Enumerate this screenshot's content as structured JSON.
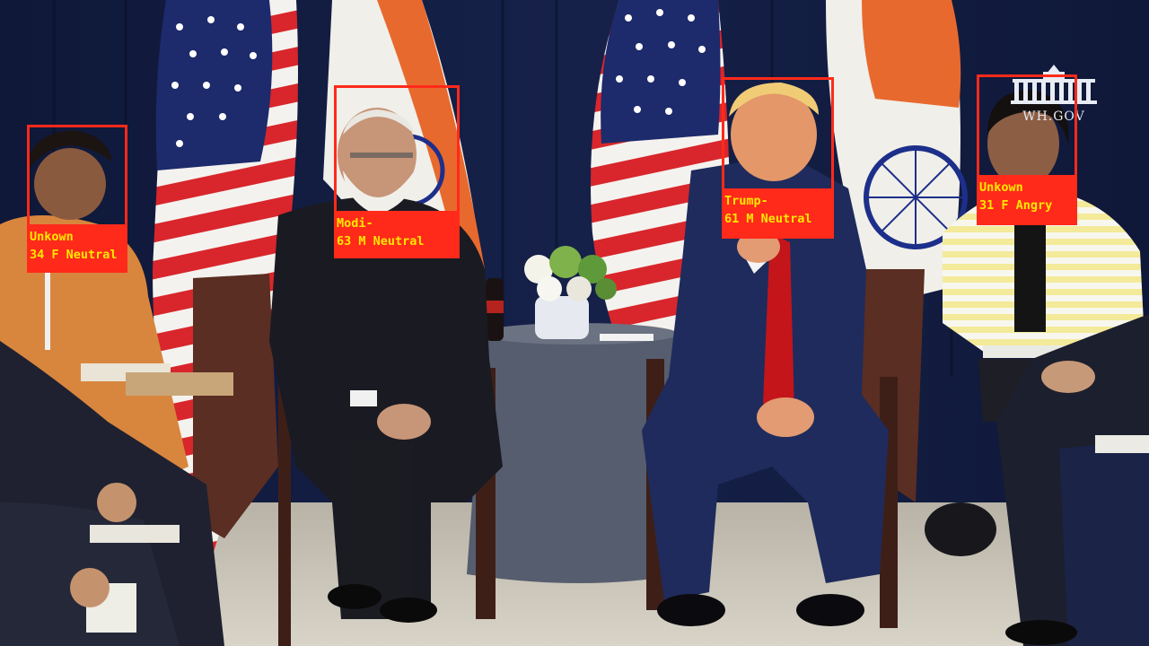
{
  "watermark": {
    "text": "WH.GOV",
    "icon": "white-house-icon"
  },
  "colors": {
    "box": "#ff2a1a",
    "label_text": "#ffe800"
  },
  "detections": [
    {
      "name": "Unkown",
      "age": "34",
      "gender": "F",
      "emotion": "Neutral",
      "line1": "Unkown",
      "line2": "34 F Neutral"
    },
    {
      "name": "Modi",
      "age": "63",
      "gender": "M",
      "emotion": "Neutral",
      "line1": "Modi-",
      "line2": "63 M Neutral"
    },
    {
      "name": "Trump",
      "age": "61",
      "gender": "M",
      "emotion": "Neutral",
      "line1": "Trump-",
      "line2": "61 M Neutral"
    },
    {
      "name": "Unkown",
      "age": "31",
      "gender": "F",
      "emotion": "Angry",
      "line1": "Unkown",
      "line2": "31 F Angry"
    }
  ]
}
